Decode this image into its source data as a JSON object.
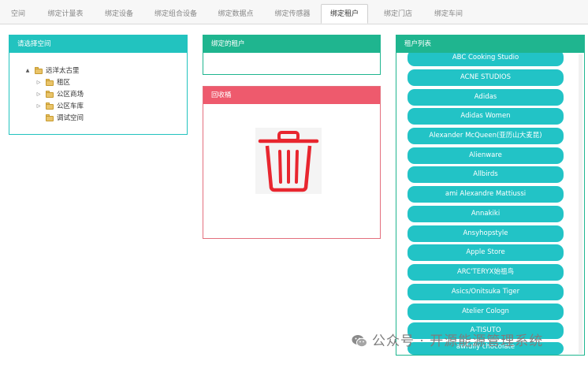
{
  "tabs": [
    {
      "label": "空间",
      "active": false
    },
    {
      "label": "绑定计量表",
      "active": false
    },
    {
      "label": "绑定设备",
      "active": false
    },
    {
      "label": "绑定组合设备",
      "active": false
    },
    {
      "label": "绑定数据点",
      "active": false
    },
    {
      "label": "绑定传感器",
      "active": false
    },
    {
      "label": "绑定租户",
      "active": true
    },
    {
      "label": "绑定门店",
      "active": false
    },
    {
      "label": "绑定车间",
      "active": false
    }
  ],
  "space_panel": {
    "title": "请选择空间",
    "tree": [
      {
        "label": "远洋太古里",
        "arrow": "▲"
      },
      {
        "label": "租区",
        "arrow": "▷"
      },
      {
        "label": "公区商场",
        "arrow": "▷"
      },
      {
        "label": "公区车库",
        "arrow": "▷"
      },
      {
        "label": "调试空间",
        "arrow": ""
      }
    ]
  },
  "bound_panel": {
    "title": "绑定的租户"
  },
  "bin_panel": {
    "title": "回收桶",
    "icon": "trash-bin-icon"
  },
  "tenant_panel": {
    "title": "租户列表",
    "tenants": [
      "ABC Cooking Studio",
      "ACNE STUDIOS",
      "Adidas",
      "Adidas Women",
      "Alexander McQueen(亚历山大麦昆)",
      "Alienware",
      "Allbirds",
      "ami Alexandre Mattiussi",
      "Annakiki",
      "Ansyhopstyle",
      "Apple Store",
      "ARC'TERYX始祖鸟",
      "Asics/Onitsuka Tiger",
      "Atelier Cologn",
      "A-TISUTO",
      "awfully chocolate"
    ]
  },
  "watermark": {
    "text": "公众号 · 开源能源管理系统",
    "icon": "wechat-icon"
  },
  "colors": {
    "space_header": "#22c3bf",
    "bound_header": "#1fb58f",
    "bin_header": "#ee5a6d",
    "tenant_button": "#22c3c6",
    "trash_red": "#e8262f"
  }
}
